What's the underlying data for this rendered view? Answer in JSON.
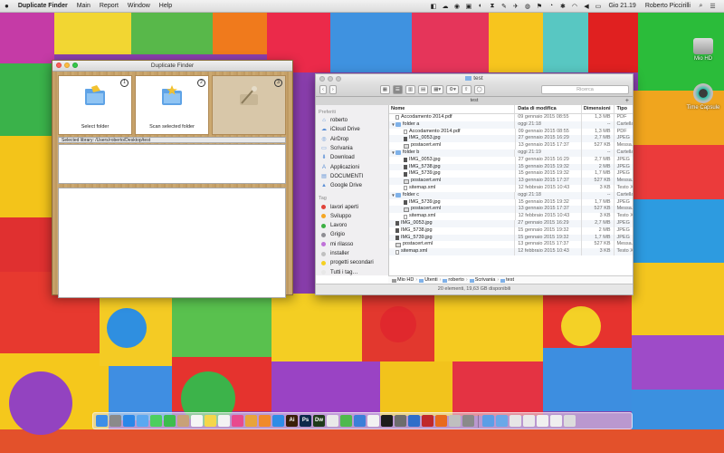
{
  "menubar": {
    "apple": "",
    "app_name": "Duplicate Finder",
    "menus": [
      "Main",
      "Report",
      "Window",
      "Help"
    ],
    "clock": "Gio 21.19",
    "user": "Roberto Piccirilli"
  },
  "desktop_icons": [
    {
      "label": "Mio HD"
    },
    {
      "label": "Time Capsule"
    }
  ],
  "duplicate_finder": {
    "title": "Duplicate Finder",
    "steps": [
      {
        "num": "1",
        "label": "Select folder"
      },
      {
        "num": "2",
        "label": "Scan selected folder"
      },
      {
        "num": "3",
        "label": ""
      }
    ],
    "selected_library": "Selected library: /Users/roberto/Desktop/test"
  },
  "finder": {
    "title": "test",
    "search_placeholder": "Ricerca",
    "tab_title": "test",
    "sidebar": {
      "favorites_header": "Preferiti",
      "favorites": [
        "roberto",
        "iCloud Drive",
        "AirDrop",
        "Scrivania",
        "Download",
        "Applicazioni",
        "DOCUMENTI",
        "Google Drive"
      ],
      "tags_header": "Tag",
      "tags": [
        {
          "label": "lavori aperti",
          "color": "#e0433a"
        },
        {
          "label": "Sviluppo",
          "color": "#f5a623"
        },
        {
          "label": "Lavoro",
          "color": "#3cb043"
        },
        {
          "label": "Grigio",
          "color": "#8e8e93"
        },
        {
          "label": "mi rilasso",
          "color": "#c071d8"
        },
        {
          "label": "installer",
          "color": "#c0c0c0"
        },
        {
          "label": "progetti secondari",
          "color": "#f5d023"
        },
        {
          "label": "Tutti i tag…",
          "color": "#e8e8e8"
        }
      ]
    },
    "columns": {
      "name": "Nome",
      "date": "Data di modifica",
      "size": "Dimensioni",
      "type": "Tipo"
    },
    "rows": [
      {
        "indent": 0,
        "tri": "",
        "icon": "file",
        "name": "Accodamento 2014.pdf",
        "date": "09 gennaio 2015 08:55",
        "size": "1,3 MB",
        "type": "PDF"
      },
      {
        "indent": 0,
        "tri": "▼",
        "icon": "folder",
        "name": "folder a",
        "date": "oggi 21:18",
        "size": "--",
        "type": "Cartella"
      },
      {
        "indent": 1,
        "tri": "",
        "icon": "file",
        "name": "Accodamento 2014.pdf",
        "date": "09 gennaio 2015 08:55",
        "size": "1,3 MB",
        "type": "PDF"
      },
      {
        "indent": 1,
        "tri": "",
        "icon": "img",
        "name": "IMG_0053.jpg",
        "date": "27 gennaio 2015 16:29",
        "size": "2,7 MB",
        "type": "JPEG"
      },
      {
        "indent": 1,
        "tri": "",
        "icon": "mail",
        "name": "postacert.eml",
        "date": "13 gennaio 2015 17:37",
        "size": "527 KB",
        "type": "Messa..."
      },
      {
        "indent": 0,
        "tri": "▼",
        "icon": "folder",
        "name": "folder b",
        "date": "oggi 21:19",
        "size": "--",
        "type": "Cartella"
      },
      {
        "indent": 1,
        "tri": "",
        "icon": "img",
        "name": "IMG_0053.jpg",
        "date": "27 gennaio 2015 16:29",
        "size": "2,7 MB",
        "type": "JPEG"
      },
      {
        "indent": 1,
        "tri": "",
        "icon": "img",
        "name": "IMG_5738.jpg",
        "date": "15 gennaio 2015 19:32",
        "size": "2 MB",
        "type": "JPEG"
      },
      {
        "indent": 1,
        "tri": "",
        "icon": "img",
        "name": "IMG_5739.jpg",
        "date": "15 gennaio 2015 19:32",
        "size": "1,7 MB",
        "type": "JPEG"
      },
      {
        "indent": 1,
        "tri": "",
        "icon": "mail",
        "name": "postacert.eml",
        "date": "13 gennaio 2015 17:37",
        "size": "527 KB",
        "type": "Messa..."
      },
      {
        "indent": 1,
        "tri": "",
        "icon": "file",
        "name": "sitemap.xml",
        "date": "12 febbraio 2015 10:43",
        "size": "3 KB",
        "type": "Testo XML"
      },
      {
        "indent": 0,
        "tri": "▼",
        "icon": "folder",
        "name": "folder c",
        "date": "oggi 21:18",
        "size": "--",
        "type": "Cartella"
      },
      {
        "indent": 1,
        "tri": "",
        "icon": "img",
        "name": "IMG_5739.jpg",
        "date": "15 gennaio 2015 19:32",
        "size": "1,7 MB",
        "type": "JPEG"
      },
      {
        "indent": 1,
        "tri": "",
        "icon": "mail",
        "name": "postacert.eml",
        "date": "13 gennaio 2015 17:37",
        "size": "527 KB",
        "type": "Messa..."
      },
      {
        "indent": 1,
        "tri": "",
        "icon": "file",
        "name": "sitemap.xml",
        "date": "12 febbraio 2015 10:43",
        "size": "3 KB",
        "type": "Testo XML"
      },
      {
        "indent": 0,
        "tri": "",
        "icon": "img",
        "name": "IMG_0053.jpg",
        "date": "27 gennaio 2015 16:29",
        "size": "2,7 MB",
        "type": "JPEG"
      },
      {
        "indent": 0,
        "tri": "",
        "icon": "img",
        "name": "IMG_5738.jpg",
        "date": "15 gennaio 2015 19:32",
        "size": "2 MB",
        "type": "JPEG"
      },
      {
        "indent": 0,
        "tri": "",
        "icon": "img",
        "name": "IMG_5739.jpg",
        "date": "15 gennaio 2015 19:32",
        "size": "1,7 MB",
        "type": "JPEG"
      },
      {
        "indent": 0,
        "tri": "",
        "icon": "mail",
        "name": "postacert.eml",
        "date": "13 gennaio 2015 17:37",
        "size": "527 KB",
        "type": "Messa..."
      },
      {
        "indent": 0,
        "tri": "",
        "icon": "file",
        "name": "sitemap.xml",
        "date": "12 febbraio 2015 10:43",
        "size": "3 KB",
        "type": "Testo XML"
      }
    ],
    "path": [
      "Mio HD",
      "Utenti",
      "roberto",
      "Scrivania",
      "test"
    ],
    "status": "20 elementi, 19,63 GB disponibili"
  },
  "dock": {
    "apps": [
      {
        "name": "finder-icon",
        "color": "#3d8ee8"
      },
      {
        "name": "launchpad-icon",
        "color": "#8a8a8a"
      },
      {
        "name": "safari-icon",
        "color": "#2a87e8"
      },
      {
        "name": "mail-icon",
        "color": "#5ba8f0"
      },
      {
        "name": "messages-icon",
        "color": "#4ccf5e"
      },
      {
        "name": "facetime-icon",
        "color": "#3dbd4d"
      },
      {
        "name": "contacts-icon",
        "color": "#c8a178"
      },
      {
        "name": "calendar-icon",
        "color": "#f6f6f6"
      },
      {
        "name": "notes-icon",
        "color": "#f5d64a"
      },
      {
        "name": "reminders-icon",
        "color": "#f3f3f3"
      },
      {
        "name": "itunes-icon",
        "color": "#e84a8e"
      },
      {
        "name": "photos-icon",
        "color": "#e8a43a"
      },
      {
        "name": "ibooks-icon",
        "color": "#f08a2a"
      },
      {
        "name": "appstore-icon",
        "color": "#2f8ce6"
      },
      {
        "name": "illustrator-icon",
        "color": "#3a1e08"
      },
      {
        "name": "photoshop-icon",
        "color": "#0d2a4a"
      },
      {
        "name": "dreamweaver-icon",
        "color": "#1f3a1a"
      },
      {
        "name": "preview-icon",
        "color": "#e9e9e9"
      },
      {
        "name": "numbers-icon",
        "color": "#4fb94d"
      },
      {
        "name": "keynote-icon",
        "color": "#3b7fd8"
      },
      {
        "name": "textedit-icon",
        "color": "#f2f2f2"
      },
      {
        "name": "terminal-icon",
        "color": "#1c1c1c"
      },
      {
        "name": "activity-icon",
        "color": "#6d6d6d"
      },
      {
        "name": "xcode-icon",
        "color": "#2f6ec9"
      },
      {
        "name": "filezilla-icon",
        "color": "#c0282a"
      },
      {
        "name": "firefox-icon",
        "color": "#e86a1e"
      },
      {
        "name": "spotlight-icon",
        "color": "#bfbfbf"
      },
      {
        "name": "preferences-icon",
        "color": "#8a8a8a"
      },
      {
        "name": "downloads-stack-icon",
        "color": "#5b9ee6"
      },
      {
        "name": "documents-stack-icon",
        "color": "#6aa8e8"
      },
      {
        "name": "desktop-stack-icon",
        "color": "#e6e6e6"
      },
      {
        "name": "screen1-icon",
        "color": "#eaeaea"
      },
      {
        "name": "screen2-icon",
        "color": "#f0f0f0"
      },
      {
        "name": "screen3-icon",
        "color": "#efefef"
      },
      {
        "name": "trash-icon",
        "color": "#dcdcdc"
      }
    ],
    "dock_labels": {
      "illustrator-icon": "Ai",
      "photoshop-icon": "Ps",
      "dreamweaver-icon": "Dw"
    }
  }
}
